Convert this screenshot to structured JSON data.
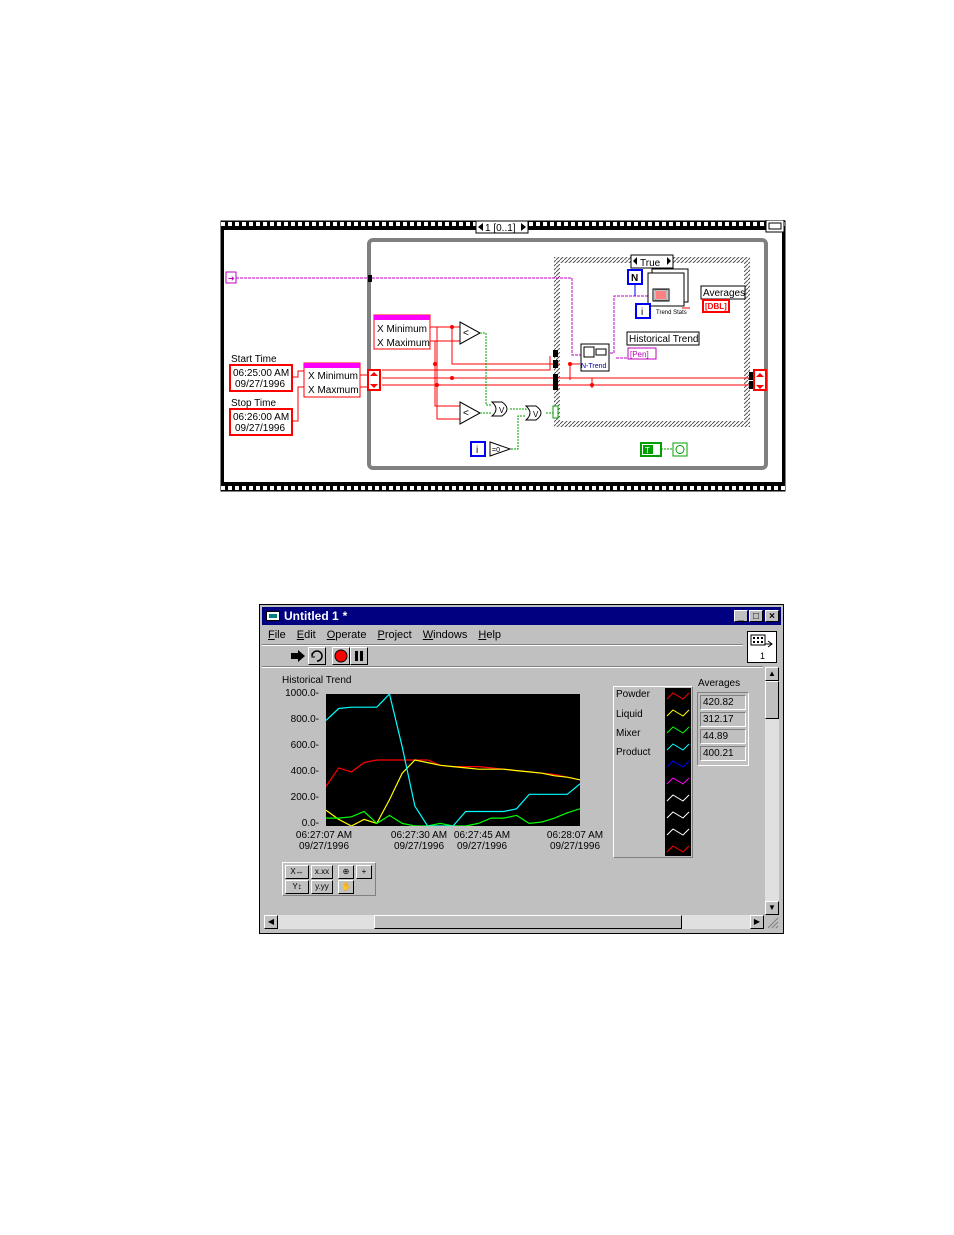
{
  "diagram": {
    "sequence_label": "1 [0..1]",
    "case_label": "True",
    "start_time_label": "Start Time",
    "start_time_value": "06:25:00 AM",
    "start_date_value": "09/27/1996",
    "stop_time_label": "Stop Time",
    "stop_time_value": "06:26:00 AM",
    "stop_date_value": "09/27/1996",
    "x_minimum_1": "X Minimum",
    "x_maximum_1": "X Maximum",
    "x_minimum_2": "X Minimum",
    "x_maximum_2": "X Maxmum",
    "averages_label": "Averages",
    "dbl_label": "[DBL]",
    "historical_trend_label": "Historical Trend",
    "ntrend_label": "N-Trend",
    "pen_label": "[Pen]",
    "n_terminal": "N",
    "i_terminal": "i",
    "trend_stats": "Trend Stats",
    "less_than_1": "<",
    "less_than_2": "<",
    "true_const": "T",
    "colors": {
      "wire_pink": "#c000c0",
      "wire_red": "#ff0000",
      "wire_green": "#00a000",
      "frame_gray": "#808080"
    }
  },
  "window": {
    "title": "Untitled 1",
    "title_mark": "*",
    "menu": [
      "File",
      "Edit",
      "Operate",
      "Project",
      "Windows",
      "Help"
    ],
    "minimize": "_",
    "maximize": "□",
    "close": "×",
    "icon_pane_num": "1",
    "chart_title": "Historical Trend",
    "y_ticks": [
      "1000.0-",
      "800.0-",
      "600.0-",
      "400.0-",
      "200.0-",
      "0.0-"
    ],
    "x_ticks": [
      {
        "time": "06:27:07 AM",
        "date": "09/27/1996"
      },
      {
        "time": "06:27:30 AM",
        "date": "09/27/1996"
      },
      {
        "time": "06:27:45 AM",
        "date": "09/27/1996"
      },
      {
        "time": "06:28:07 AM",
        "date": "09/27/1996"
      }
    ],
    "legend": [
      "Powder",
      "Liquid",
      "Mixer",
      "Product"
    ],
    "averages_label": "Averages",
    "averages": [
      "420.82",
      "312.17",
      "44.89",
      "400.21"
    ],
    "palette": {
      "x_fmt": "x.xx",
      "y_fmt": "y.yy"
    }
  },
  "chart_data": {
    "type": "line",
    "title": "Historical Trend",
    "ylim": [
      0,
      1000
    ],
    "x": [
      "06:27:07 AM",
      "06:27:10 AM",
      "06:27:13 AM",
      "06:27:16 AM",
      "06:27:19 AM",
      "06:27:22 AM",
      "06:27:25 AM",
      "06:27:28 AM",
      "06:27:31 AM",
      "06:27:34 AM",
      "06:27:37 AM",
      "06:27:40 AM",
      "06:27:43 AM",
      "06:27:46 AM",
      "06:27:49 AM",
      "06:27:52 AM",
      "06:27:55 AM",
      "06:27:58 AM",
      "06:28:01 AM",
      "06:28:04 AM",
      "06:28:07 AM"
    ],
    "series": [
      {
        "name": "Powder",
        "color": "#ff0000",
        "values": [
          300,
          440,
          410,
          480,
          500,
          500,
          500,
          500,
          500,
          460,
          450,
          450,
          450,
          440,
          430,
          420,
          410,
          400,
          390,
          370,
          350
        ]
      },
      {
        "name": "Liquid",
        "color": "#ffff00",
        "values": [
          120,
          50,
          0,
          50,
          20,
          200,
          400,
          500,
          480,
          460,
          450,
          440,
          430,
          430,
          430,
          420,
          410,
          400,
          380,
          370,
          350
        ]
      },
      {
        "name": "Mixer",
        "color": "#00ff00",
        "values": [
          60,
          60,
          70,
          110,
          20,
          80,
          20,
          0,
          0,
          20,
          0,
          0,
          20,
          60,
          60,
          80,
          20,
          30,
          60,
          100,
          130
        ]
      },
      {
        "name": "Product",
        "color": "#00ffff",
        "values": [
          800,
          890,
          900,
          900,
          900,
          1000,
          600,
          150,
          0,
          0,
          0,
          110,
          110,
          110,
          110,
          130,
          240,
          240,
          240,
          240,
          320
        ]
      }
    ],
    "legend": [
      "Powder",
      "Liquid",
      "Mixer",
      "Product"
    ]
  }
}
